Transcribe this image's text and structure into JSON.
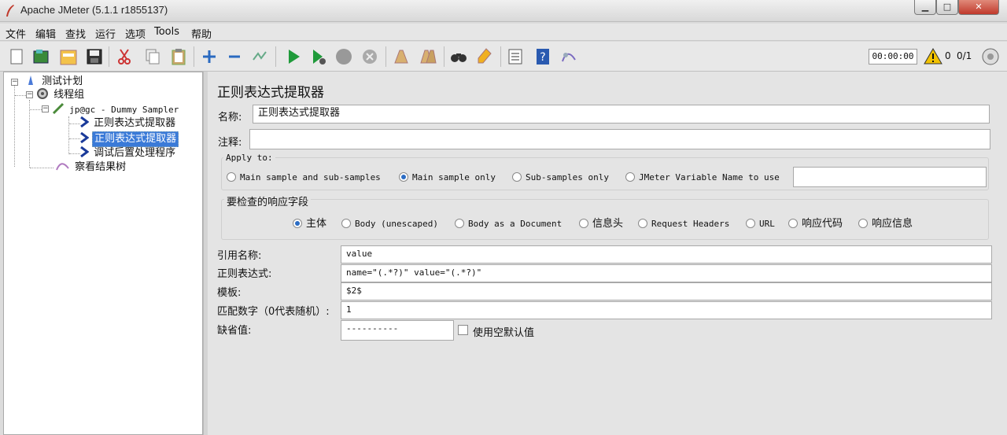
{
  "window": {
    "title": "Apache JMeter (5.1.1 r1855137)"
  },
  "menu": [
    "文件",
    "编辑",
    "查找",
    "运行",
    "选项",
    "Tools",
    "帮助"
  ],
  "toolbar": {
    "timer": "00:00:00",
    "warning_count": "0",
    "thread_count": "0/1",
    "icons": [
      "new-icon",
      "templates-icon",
      "open-icon",
      "save-icon",
      "cut-icon",
      "copy-icon",
      "paste-icon",
      "expand-icon",
      "collapse-icon",
      "toggle-icon",
      "start-icon",
      "start-no-pause-icon",
      "stop-icon",
      "shutdown-icon",
      "clear-icon",
      "clear-all-icon",
      "search-icon",
      "reset-search-icon",
      "function-helper-icon",
      "help-icon",
      "remote-icon"
    ]
  },
  "tree": {
    "test_plan": "测试计划",
    "thread_group": "线程组",
    "sampler": "jp@gc - Dummy Sampler",
    "extractor_1": "正则表达式提取器",
    "extractor_2": "正则表达式提取器",
    "post_processor": "调试后置处理程序",
    "listener": "察看结果树"
  },
  "panel": {
    "title": "正则表达式提取器",
    "name_label": "名称:",
    "name_value": "正则表达式提取器",
    "comment_label": "注释:",
    "comment_value": "",
    "apply_to": {
      "title": "Apply to:",
      "options": [
        "Main sample and sub-samples",
        "Main sample only",
        "Sub-samples only",
        "JMeter Variable Name to use"
      ],
      "selected": "Main sample only",
      "variable_value": ""
    },
    "field_to_check": {
      "title": "要检查的响应字段",
      "options": [
        "主体",
        "Body (unescaped)",
        "Body as a Document",
        "信息头",
        "Request Headers",
        "URL",
        "响应代码",
        "响应信息"
      ],
      "selected": "主体"
    },
    "ref_name_label": "引用名称:",
    "ref_name_value": "value",
    "regex_label": "正则表达式:",
    "regex_value": "name=\"(.*?)\"  value=\"(.*?)\"",
    "template_label": "模板:",
    "template_value": "$2$",
    "match_no_label": "匹配数字（0代表随机）:",
    "match_no_value": "1",
    "default_label": "缺省值:",
    "default_value": "----------",
    "use_empty_label": "使用空默认值",
    "use_empty_checked": false
  }
}
